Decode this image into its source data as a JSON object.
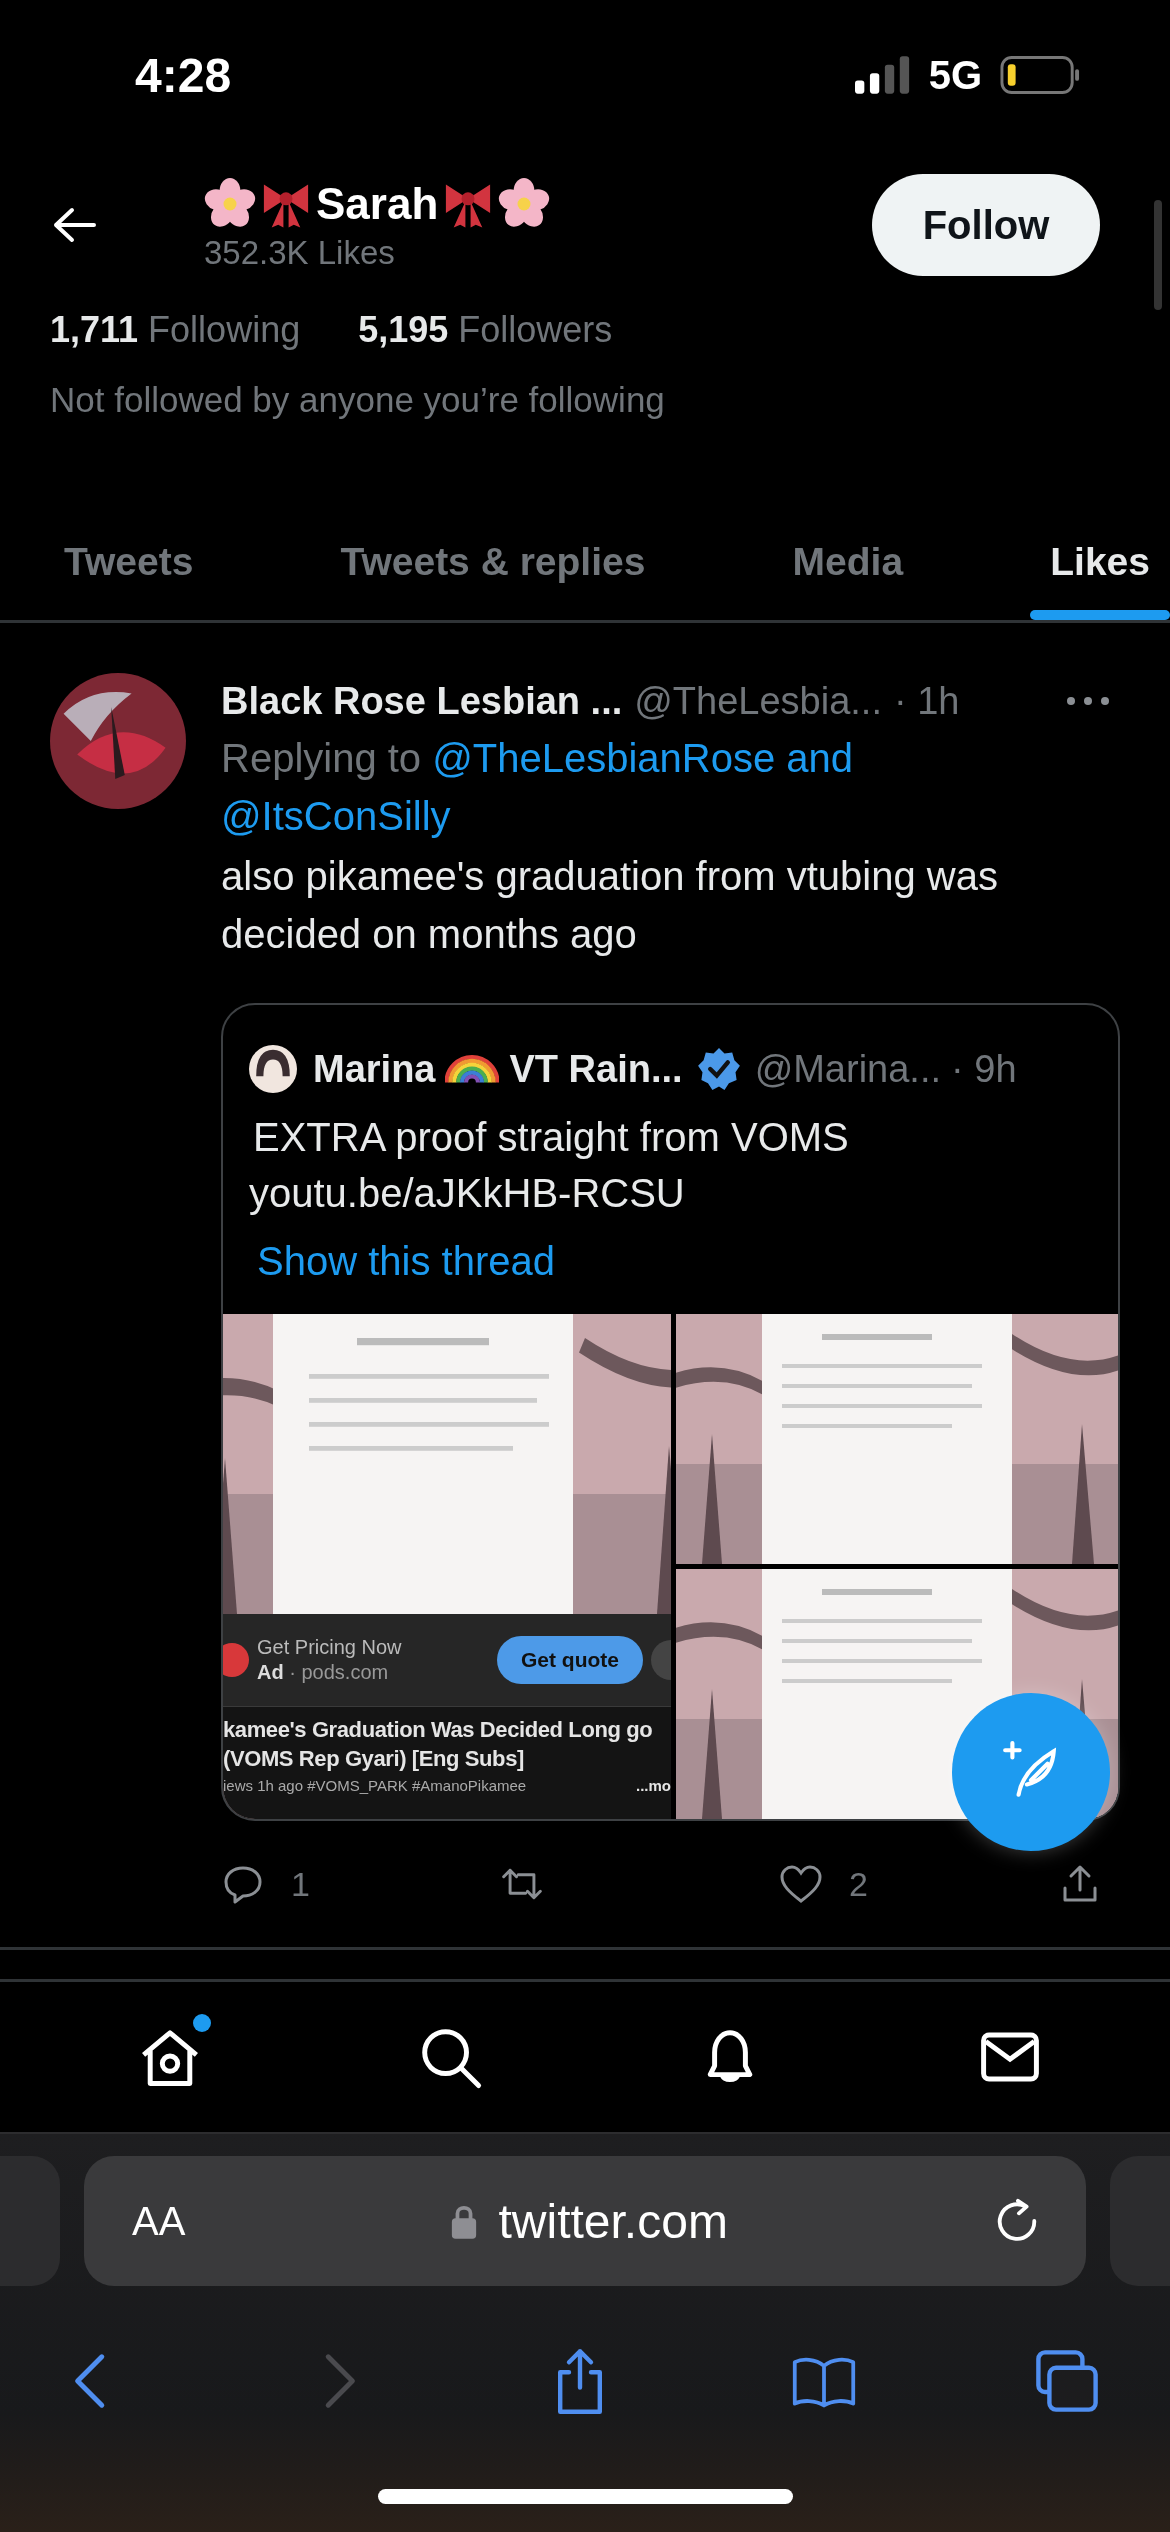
{
  "status_bar": {
    "time": "4:28",
    "network": "5G"
  },
  "profile": {
    "name": "Sarah",
    "likes": "352.3K Likes",
    "follow_button": "Follow",
    "following_count": "1,711",
    "following_label": "Following",
    "followers_count": "5,195",
    "followers_label": "Followers",
    "note": "Not followed by anyone you’re following"
  },
  "tabs": [
    {
      "label": "Tweets",
      "selected": false
    },
    {
      "label": "Tweets & replies",
      "selected": false
    },
    {
      "label": "Media",
      "selected": false
    },
    {
      "label": "Likes",
      "selected": true
    }
  ],
  "tweet": {
    "author": "Black Rose Lesbian ...",
    "handle": "@TheLesbia...",
    "time": "· 1h",
    "replying_prefix": "Replying to",
    "mentions": [
      "@TheLesbianRose and",
      "@ItsConSilly"
    ],
    "text": "also pikamee's graduation from vtubing was decided on months ago",
    "quote": {
      "author": "Marina",
      "author_suffix": "VT Rain...",
      "verified": true,
      "handle": "@Marina...",
      "time": "· 9h",
      "text": "EXTRA proof straight from VOMS",
      "link": "youtu.be/aJKkHB-RCSU",
      "show_thread": "Show this thread",
      "media": [
        {
          "kind": "video_screenshot",
          "ad_title": "Get Pricing Now",
          "ad_label": "Ad",
          "ad_domain": "· pods.com",
          "ad_button": "Get quote",
          "video_title": "kamee's Graduation Was Decided Long go (VOMS Rep Gyari) [Eng Subs]",
          "video_meta": "iews 1h ago #VOMS_PARK #AmanoPikamee",
          "video_more": "...mo"
        },
        {
          "kind": "picture"
        },
        {
          "kind": "picture"
        }
      ]
    },
    "actions": {
      "replies": "1",
      "likes": "2"
    }
  },
  "nav": [
    {
      "kind": "home",
      "dot": true
    },
    {
      "kind": "search",
      "dot": false
    },
    {
      "kind": "notifications",
      "dot": false
    },
    {
      "kind": "messages",
      "dot": false
    }
  ],
  "browser": {
    "text_size": "AA",
    "url": "twitter.com",
    "toolbar": [
      {
        "kind": "back",
        "disabled": false
      },
      {
        "kind": "forward",
        "disabled": true
      },
      {
        "kind": "share",
        "disabled": false
      },
      {
        "kind": "bookmarks",
        "disabled": false
      },
      {
        "kind": "tabs",
        "disabled": false
      }
    ]
  }
}
